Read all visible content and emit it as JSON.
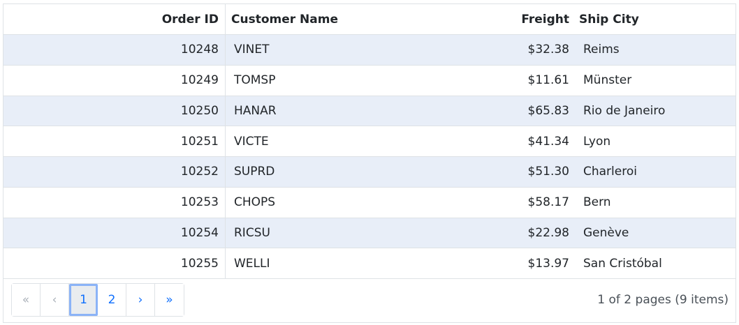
{
  "grid": {
    "columns": {
      "order_id": "Order ID",
      "customer_name": "Customer Name",
      "freight": "Freight",
      "ship_city": "Ship City"
    },
    "rows": [
      {
        "order_id": "10248",
        "customer_name": "VINET",
        "freight": "$32.38",
        "ship_city": "Reims"
      },
      {
        "order_id": "10249",
        "customer_name": "TOMSP",
        "freight": "$11.61",
        "ship_city": "Münster"
      },
      {
        "order_id": "10250",
        "customer_name": "HANAR",
        "freight": "$65.83",
        "ship_city": "Rio de Janeiro"
      },
      {
        "order_id": "10251",
        "customer_name": "VICTE",
        "freight": "$41.34",
        "ship_city": "Lyon"
      },
      {
        "order_id": "10252",
        "customer_name": "SUPRD",
        "freight": "$51.30",
        "ship_city": "Charleroi"
      },
      {
        "order_id": "10253",
        "customer_name": "CHOPS",
        "freight": "$58.17",
        "ship_city": "Bern"
      },
      {
        "order_id": "10254",
        "customer_name": "RICSU",
        "freight": "$22.98",
        "ship_city": "Genève"
      },
      {
        "order_id": "10255",
        "customer_name": "WELLI",
        "freight": "$13.97",
        "ship_city": "San Cristóbal"
      }
    ]
  },
  "pager": {
    "first": "«",
    "prev": "‹",
    "pages": [
      "1",
      "2"
    ],
    "current_page": "1",
    "next": "›",
    "last": "»",
    "info": "1 of 2 pages (9 items)"
  },
  "colors": {
    "alt_row": "#e8eef8",
    "accent": "#0d6efd",
    "border": "#dee2e6"
  }
}
